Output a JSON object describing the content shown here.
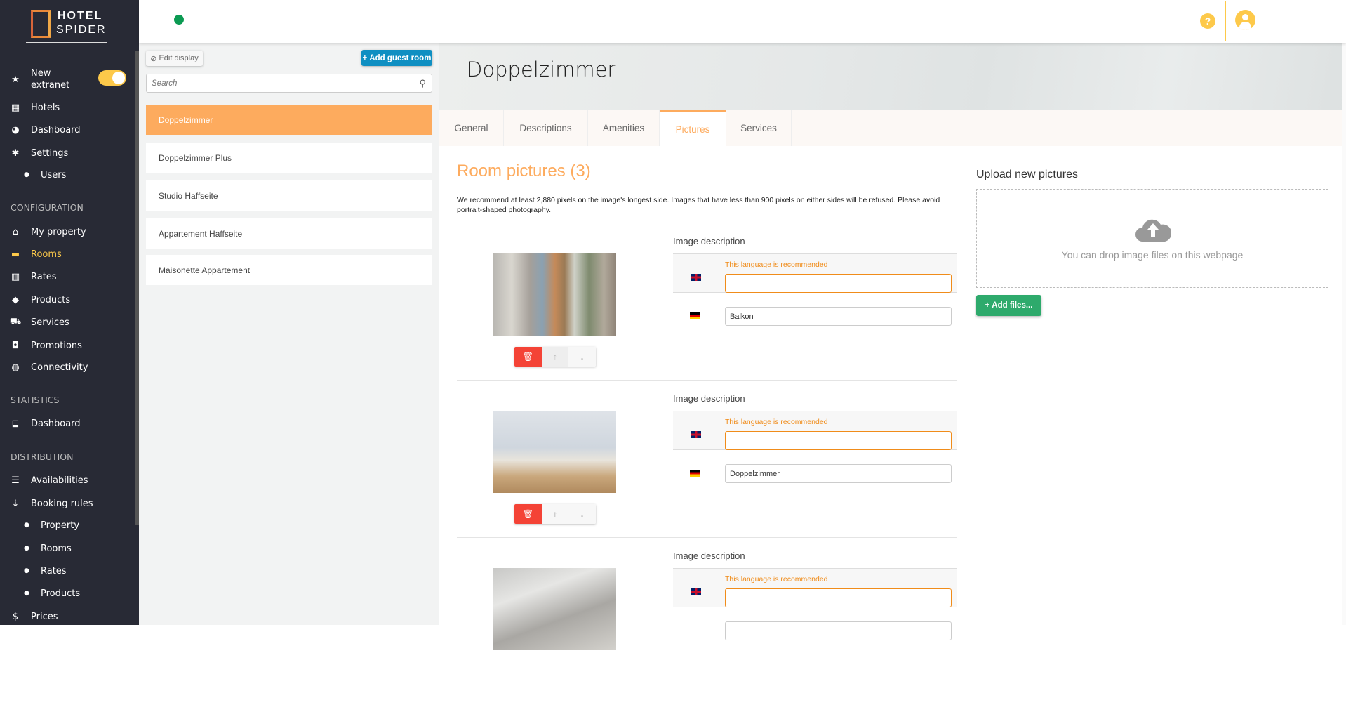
{
  "brand": {
    "line1": "HOTEL",
    "line2": "SPIDER"
  },
  "sidebar": {
    "new_extranet": "New extranet",
    "new_extranet_on": true,
    "items": [
      {
        "label": "Hotels",
        "icon": "building-icon"
      },
      {
        "label": "Dashboard",
        "icon": "palette-icon"
      },
      {
        "label": "Settings",
        "icon": "gear-icon"
      },
      {
        "label": "Users"
      }
    ],
    "sections": {
      "configuration": "CONFIGURATION",
      "statistics": "STATISTICS",
      "distribution": "DISTRIBUTION"
    },
    "configuration": [
      {
        "label": "My property"
      },
      {
        "label": "Rooms",
        "active": true
      },
      {
        "label": "Rates"
      },
      {
        "label": "Products"
      },
      {
        "label": "Services"
      },
      {
        "label": "Promotions"
      },
      {
        "label": "Connectivity"
      }
    ],
    "statistics": [
      {
        "label": "Dashboard"
      }
    ],
    "distribution": [
      {
        "label": "Availabilities"
      },
      {
        "label": "Booking rules"
      },
      {
        "label": "Property"
      },
      {
        "label": "Rooms"
      },
      {
        "label": "Rates"
      },
      {
        "label": "Products"
      },
      {
        "label": "Prices"
      }
    ]
  },
  "header": {
    "help": "?"
  },
  "room_list": {
    "edit_display": "Edit display",
    "add_room": "Add guest room",
    "search_placeholder": "Search",
    "rooms": [
      "Doppelzimmer",
      "Doppelzimmer Plus",
      "Studio Haffseite",
      "Appartement Haffseite",
      "Maisonette Appartement"
    ],
    "selected": "Doppelzimmer"
  },
  "main": {
    "title": "Doppelzimmer",
    "tabs": [
      "General",
      "Descriptions",
      "Amenities",
      "Pictures",
      "Services"
    ],
    "active_tab": "Pictures",
    "pictures_heading": "Room pictures (3)",
    "recommendation": "We recommend at least 2,880 pixels on the image's longest side. Images that have less than 900 pixels on either sides will be refused. Please avoid portrait-shaped photography.",
    "desc_label": "Image description",
    "recommended_lang": "This language is recommended",
    "pictures": [
      {
        "en": "",
        "de": "Balkon"
      },
      {
        "en": "",
        "de": "Doppelzimmer"
      },
      {
        "en": "",
        "de": ""
      }
    ]
  },
  "upload": {
    "title": "Upload new pictures",
    "drop_text": "You can drop image files on this webpage",
    "add_files": "Add files..."
  },
  "colors": {
    "accent": "#fdab5e",
    "sidebar": "#282a35",
    "primary": "#0f8fc2",
    "success": "#2eaa6c",
    "danger": "#f44336",
    "highlight": "#fdc94a"
  }
}
